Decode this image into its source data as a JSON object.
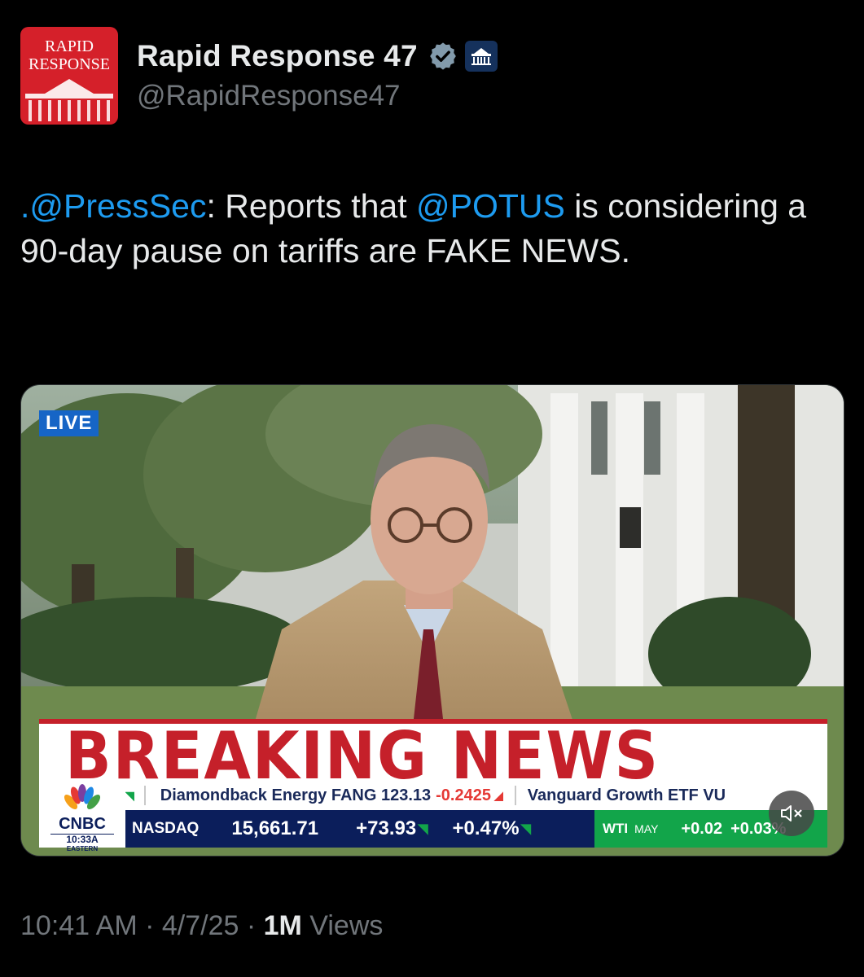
{
  "author": {
    "avatar_line1": "RAPID",
    "avatar_line2": "RESPONSE",
    "display_name": "Rapid Response 47",
    "handle": "@RapidResponse47",
    "verified_icon": "verified-badge-icon",
    "affiliation_icon": "white-house-icon"
  },
  "tweet": {
    "mention1": ".@PressSec",
    "text_part1": ": Reports that ",
    "mention2": "@POTUS",
    "text_part2": " is considering a 90-day pause on tariffs are FAKE NEWS."
  },
  "media": {
    "live_label": "LIVE",
    "banner_text": "BREAKING NEWS",
    "network_logo": "CNBC",
    "network_time": "10:33A",
    "network_zone": "EASTERN",
    "ticker_top": {
      "item1": "Diamondback Energy FANG 123.13",
      "item1_change": "-0.2425",
      "item2": "Vanguard Growth ETF VU"
    },
    "ticker_bottom": {
      "index": "NASDAQ",
      "value": "15,661.71",
      "change": "+73.93",
      "percent": "+0.47%",
      "commodity": "WTI",
      "commodity_month": "MAY",
      "commodity_change": "+0.02",
      "commodity_percent": "+0.03%"
    },
    "mute_icon": "speaker-muted-icon"
  },
  "meta": {
    "time": "10:41 AM",
    "sep1": " · ",
    "date": "4/7/25",
    "sep2": " · ",
    "views_count": "1M",
    "views_label": " Views"
  },
  "colors": {
    "background": "#000000",
    "mention": "#1d9bf0",
    "muted_text": "#71767b",
    "breaking_red": "#c5202a"
  }
}
